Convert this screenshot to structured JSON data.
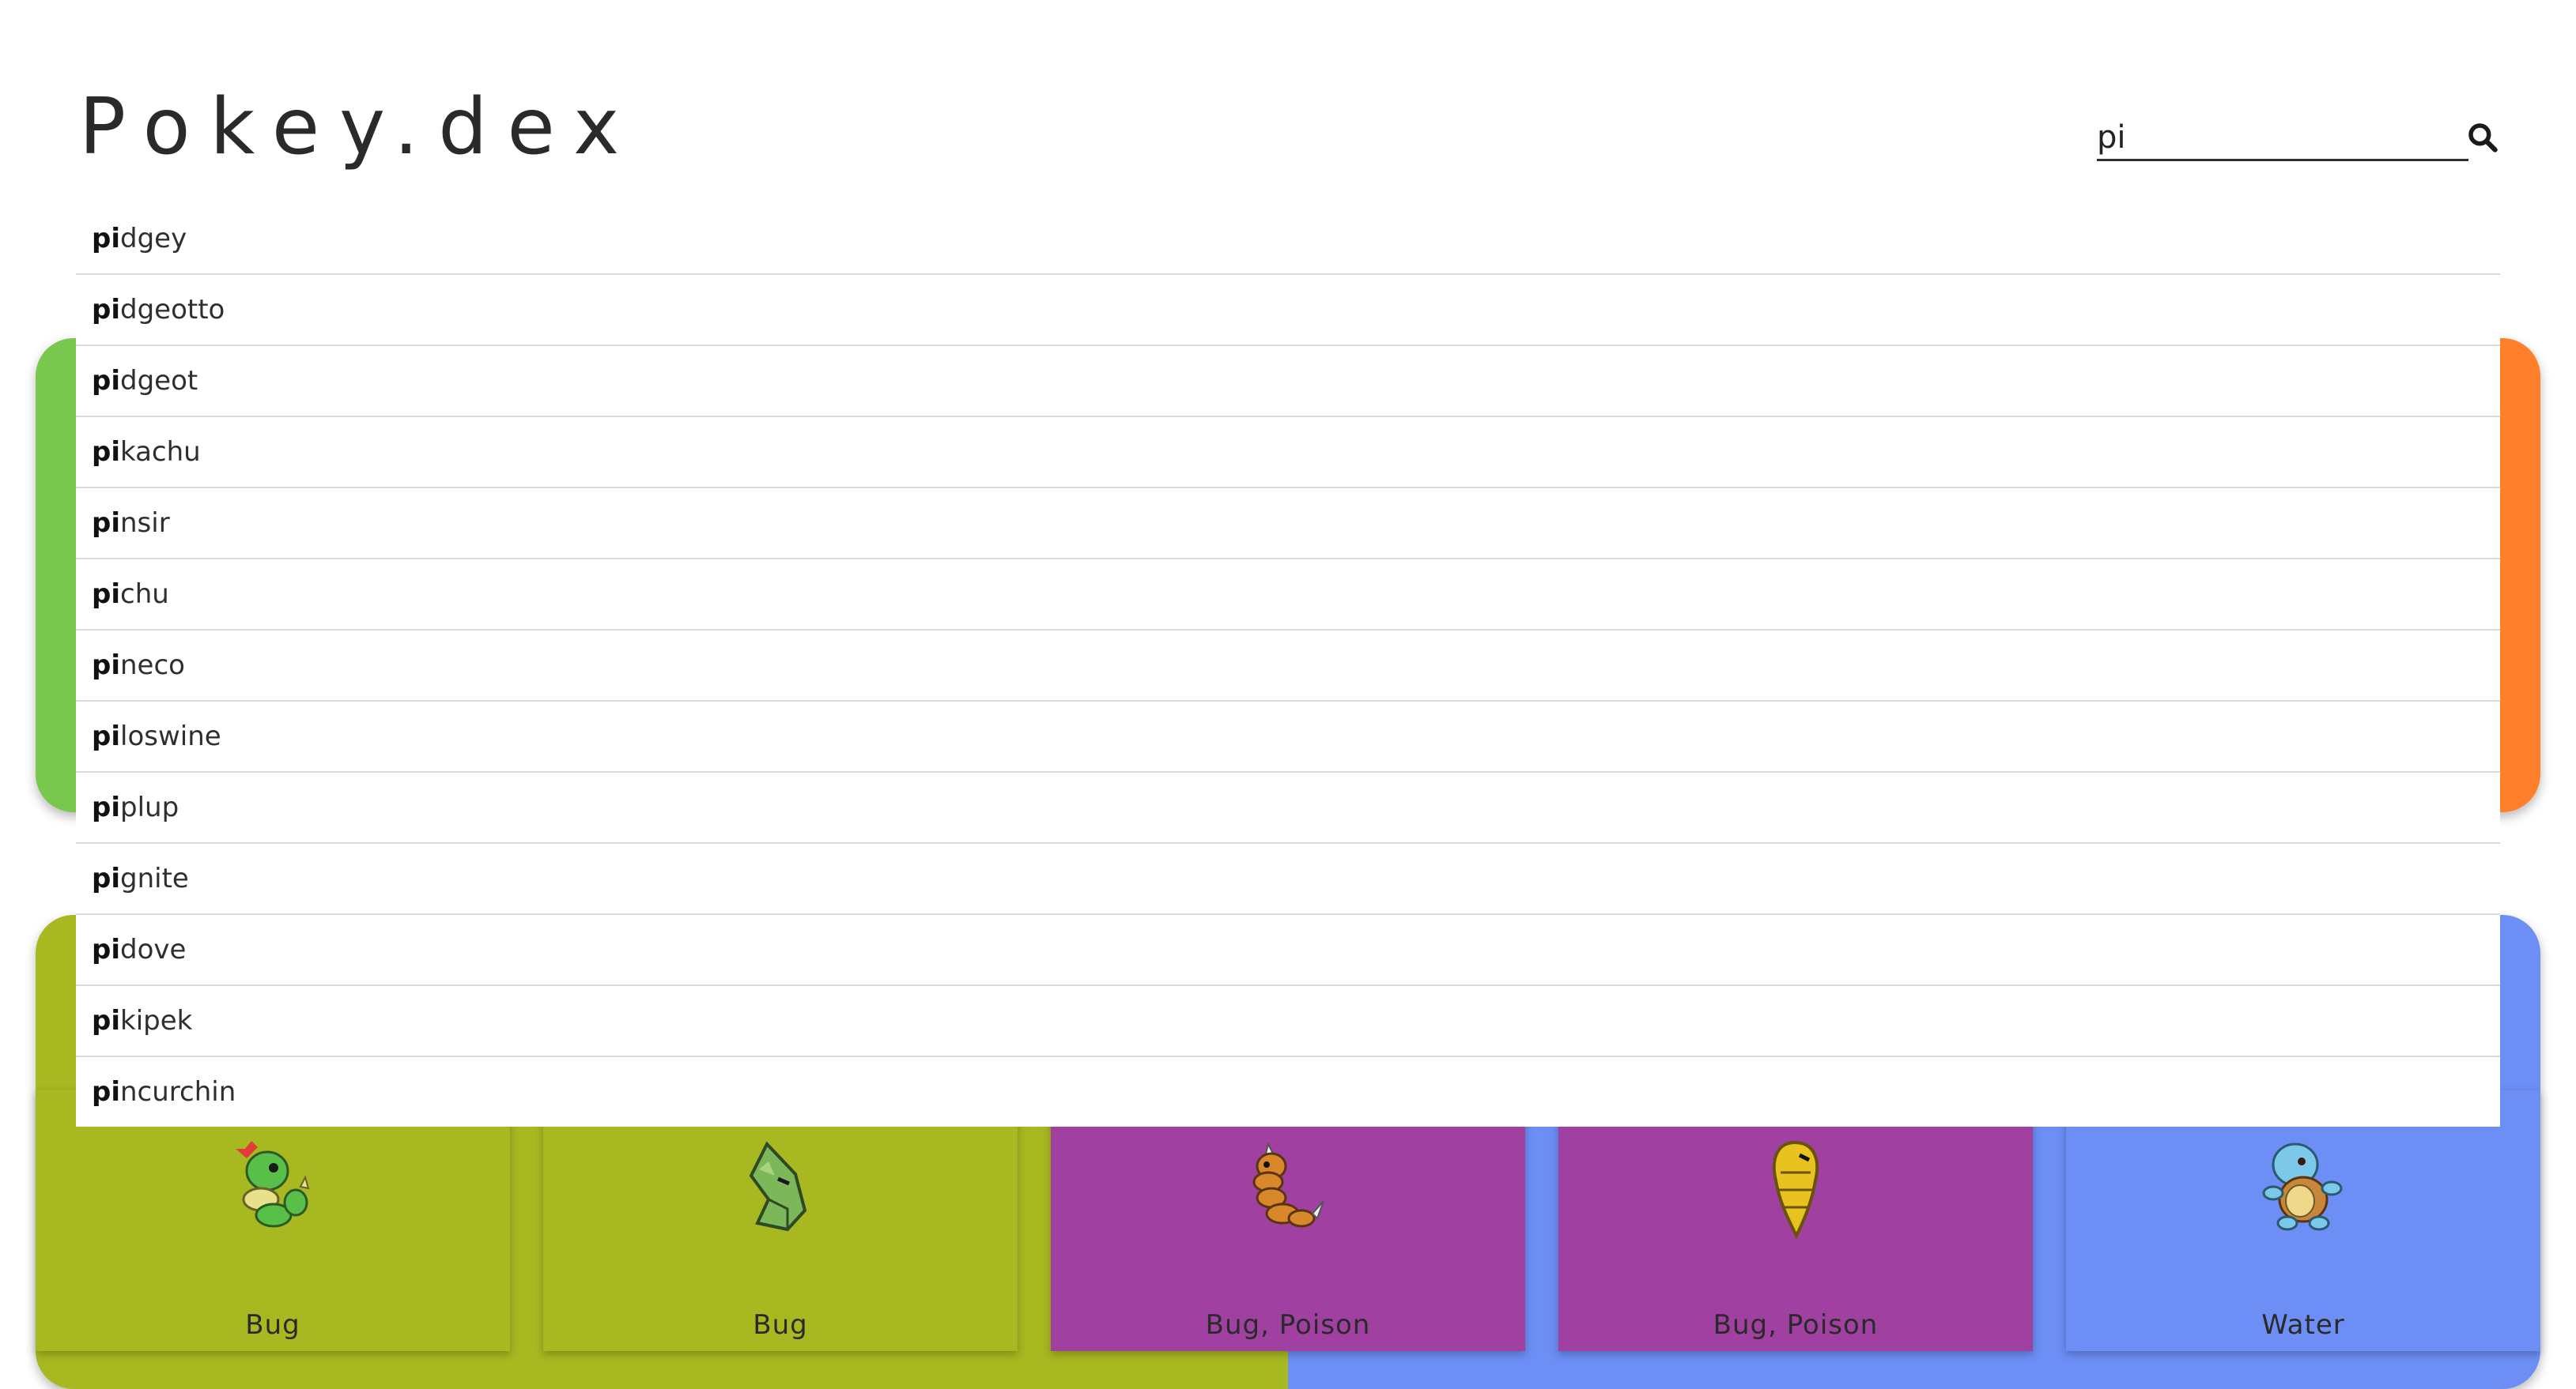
{
  "header": {
    "logo": "Pokey.dex"
  },
  "search": {
    "value": "pi",
    "icon": "search-icon"
  },
  "suggestions": [
    {
      "match": "pi",
      "rest": "dgey"
    },
    {
      "match": "pi",
      "rest": "dgeotto"
    },
    {
      "match": "pi",
      "rest": "dgeot"
    },
    {
      "match": "pi",
      "rest": "kachu"
    },
    {
      "match": "pi",
      "rest": "nsir"
    },
    {
      "match": "pi",
      "rest": "chu"
    },
    {
      "match": "pi",
      "rest": "neco"
    },
    {
      "match": "pi",
      "rest": "loswine"
    },
    {
      "match": "pi",
      "rest": "plup"
    },
    {
      "match": "pi",
      "rest": "gnite"
    },
    {
      "match": "pi",
      "rest": "dove"
    },
    {
      "match": "pi",
      "rest": "kipek"
    },
    {
      "match": "pi",
      "rest": "ncurchin"
    }
  ],
  "cards": [
    {
      "types": "Bug",
      "color": "#a8b820",
      "sprite": "caterpie-sprite"
    },
    {
      "types": "Bug",
      "color": "#a8b820",
      "sprite": "metapod-sprite"
    },
    {
      "types": "Bug, Poison",
      "color": "#a040a0",
      "sprite": "weedle-sprite"
    },
    {
      "types": "Bug, Poison",
      "color": "#a040a0",
      "sprite": "kakuna-sprite"
    },
    {
      "types": "Water",
      "color": "#6c8ef5",
      "sprite": "squirtle-sprite"
    }
  ],
  "colors": {
    "grass": "#78c850",
    "fire": "#ff7f2a",
    "bug": "#a8b820",
    "poison": "#a040a0",
    "water": "#6c8ef5"
  }
}
